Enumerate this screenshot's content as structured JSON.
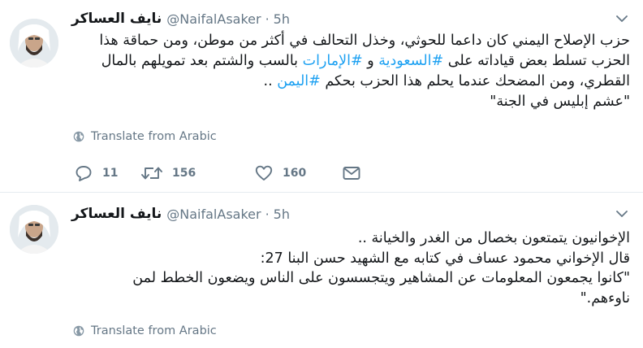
{
  "tweets": [
    {
      "display_name": "نايف العساكر",
      "handle": "@NaifalAsaker",
      "separator": "·",
      "time": "5h",
      "text_lines": [
        [
          "حزب الإصلاح اليمني كان داعما للحوثي، وخذل التحالف في أكثر من موطن، ومن حماقة هذا"
        ],
        [
          "الحزب تسلط بعض قياداته على ",
          "#السعودية",
          " و ",
          "#الإمارات",
          " بالسب والشتم بعد تمويلهم بالمال"
        ],
        [
          "القطري، ومن المضحك عندما يحلم هذا الحزب بحكم ",
          "#اليمن",
          " .."
        ],
        [
          "\"عشم إبليس في الجنة\""
        ]
      ],
      "translate_label": "Translate from Arabic",
      "reply_count": "11",
      "retweet_count": "156",
      "like_count": "160"
    },
    {
      "display_name": "نايف العساكر",
      "handle": "@NaifalAsaker",
      "separator": "·",
      "time": "5h",
      "text_lines": [
        "الإخوانيون يتمتعون بخصال من الغدر والخيانة ..",
        "قال الإخواني محمود عساف في كتابه مع الشهيد حسن البنا 27:",
        "\"كانوا يجمعون المعلومات عن المشاهير ويتجسسون على الناس ويضعون الخطط لمن",
        "ناوءهم.\""
      ],
      "translate_label": "Translate from Arabic"
    }
  ],
  "colors": {
    "hashtag": "#1da1f2",
    "secondary_text": "#657786",
    "primary_text": "#14171a",
    "divider": "#e6ecf0"
  },
  "icons": {
    "reply": "reply-icon",
    "retweet": "retweet-icon",
    "like": "heart-icon",
    "dm": "envelope-icon",
    "globe": "globe-icon",
    "caret": "chevron-down-icon"
  }
}
